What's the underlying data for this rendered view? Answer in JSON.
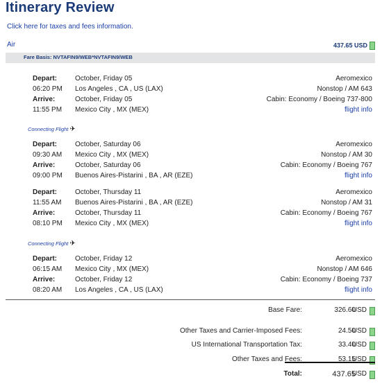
{
  "page": {
    "title": "Itinerary Review",
    "tax_link": "Click here for taxes and fees information.",
    "section": "Air",
    "air_total": "437.65 USD",
    "fare_basis": "Fare Basis: NVTAFIN9/WEB*NVTAFIN9/WEB"
  },
  "legs": [
    {
      "depart_label": "Depart:",
      "depart_date": "October, Friday 05",
      "depart_time": "06:20 PM",
      "depart_city": "Los Angeles , CA , US (LAX)",
      "arrive_label": "Arrive:",
      "arrive_date": "October, Friday 05",
      "arrive_time": "11:55 PM",
      "arrive_city": "Mexico City , MX (MEX)",
      "airline": "Aeromexico",
      "flight": "Nonstop / AM 643",
      "cabin": "Cabin: Economy / Boeing 737-800",
      "info": "flight info"
    },
    {
      "depart_label": "Depart:",
      "depart_date": "October, Saturday 06",
      "depart_time": "09:30 AM",
      "depart_city": "Mexico City , MX (MEX)",
      "arrive_label": "Arrive:",
      "arrive_date": "October, Saturday 06",
      "arrive_time": "09:00 PM",
      "arrive_city": "Buenos Aires-Pistarini , BA , AR (EZE)",
      "airline": "Aeromexico",
      "flight": "Nonstop / AM 30",
      "cabin": "Cabin: Economy / Boeing 767",
      "info": "flight info"
    },
    {
      "depart_label": "Depart:",
      "depart_date": "October, Thursday 11",
      "depart_time": "11:55 AM",
      "depart_city": "Buenos Aires-Pistarini , BA , AR (EZE)",
      "arrive_label": "Arrive:",
      "arrive_date": "October, Thursday 11",
      "arrive_time": "08:10 PM",
      "arrive_city": "Mexico City , MX (MEX)",
      "airline": "Aeromexico",
      "flight": "Nonstop / AM 31",
      "cabin": "Cabin: Economy / Boeing 767",
      "info": "flight info"
    },
    {
      "depart_label": "Depart:",
      "depart_date": "October, Friday 12",
      "depart_time": "06:15 AM",
      "depart_city": "Mexico City , MX (MEX)",
      "arrive_label": "Arrive:",
      "arrive_date": "October, Friday 12",
      "arrive_time": "08:20 AM",
      "arrive_city": "Los Angeles , CA , US (LAX)",
      "airline": "Aeromexico",
      "flight": "Nonstop / AM 646",
      "cabin": "Cabin: Economy / Boeing 737",
      "info": "flight info"
    }
  ],
  "connecting_label": "Connecting Flight",
  "fees": {
    "base_label": "Base Fare:",
    "base_amount": "326.60",
    "base_cur": "USD",
    "other_carrier_label": "Other Taxes and Carrier-Imposed Fees:",
    "other_carrier_amount": "24.50",
    "other_carrier_cur": "USD",
    "us_tax_label": "US International Transportation Tax:",
    "us_tax_amount": "33.40",
    "us_tax_cur": "USD",
    "other_label": "Other Taxes and Fees:",
    "other_amount": "53.15",
    "other_cur": "USD",
    "total_label": "Total:",
    "total_amount": "437.65",
    "total_cur": "USD"
  },
  "icons": {
    "money": "money-icon",
    "plane": "plane-icon"
  },
  "colors": {
    "title": "#1b3a78",
    "link": "#1a3ea8",
    "fare_bar": "#e3e4e6",
    "money_icon": "#8bd48b"
  }
}
